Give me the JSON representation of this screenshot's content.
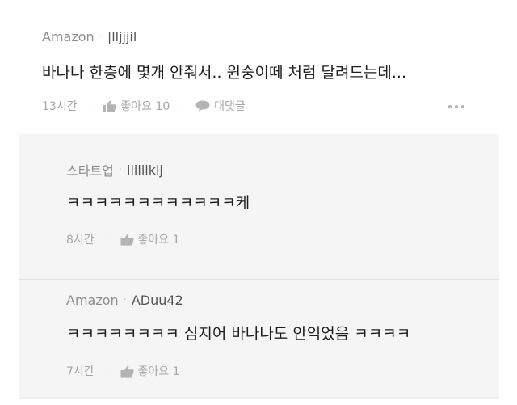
{
  "comment": {
    "company": "Amazon",
    "nickname": "|lljjjil",
    "text": "바나나 한층에 몇개 안줘서.. 원숭이떼 처럼 달려드는데...",
    "time": "13시간",
    "like_label": "좋아요 10",
    "reply_label": "대댓글"
  },
  "replies": [
    {
      "company": "스타트업",
      "nickname": "ilililklj",
      "text": "ㅋㅋㅋㅋㅋㅋㅋㅋㅋㅋㅋㅋ케",
      "time": "8시간",
      "like_label": "좋아요 1"
    },
    {
      "company": "Amazon",
      "nickname": "ADuu42",
      "text": "ㅋㅋㅋㅋㅋㅋㅋㅋ 심지어 바나나도 안익었음 ㅋㅋㅋㅋ",
      "time": "7시간",
      "like_label": "좋아요 1"
    }
  ],
  "separator_dot": "·",
  "icons": {
    "like": "thumbs-up-icon",
    "reply": "speech-bubble-icon",
    "more": "more-options-icon"
  },
  "colors": {
    "text_primary": "#1e1e1e",
    "text_muted": "#a6a6a6",
    "reply_background": "#f5f5f6"
  }
}
